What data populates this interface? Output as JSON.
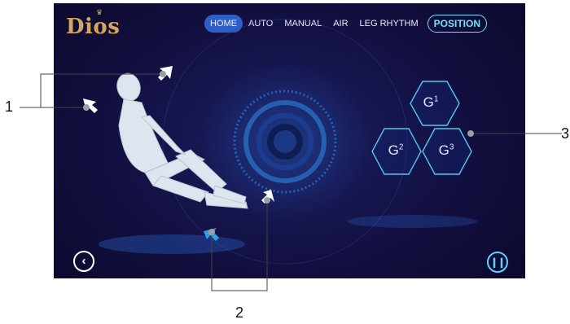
{
  "app": {
    "logo": "Dios"
  },
  "nav": {
    "items": [
      "HOME",
      "AUTO",
      "MANUAL",
      "AIR",
      "LEG RHYTHM"
    ],
    "current": "POSITION"
  },
  "positions": [
    {
      "label": "G",
      "sup": "1"
    },
    {
      "label": "G",
      "sup": "2"
    },
    {
      "label": "G",
      "sup": "3"
    }
  ],
  "callouts": [
    "1",
    "2",
    "3"
  ],
  "icons": {
    "back": "chevron-left-icon",
    "pause": "pause-icon",
    "recline": "arrow-icon",
    "leg": "arrow-icon"
  },
  "colors": {
    "accent": "#6fe0ff",
    "logo": "#d6a45a",
    "active_tab": "#2e5fc9"
  }
}
